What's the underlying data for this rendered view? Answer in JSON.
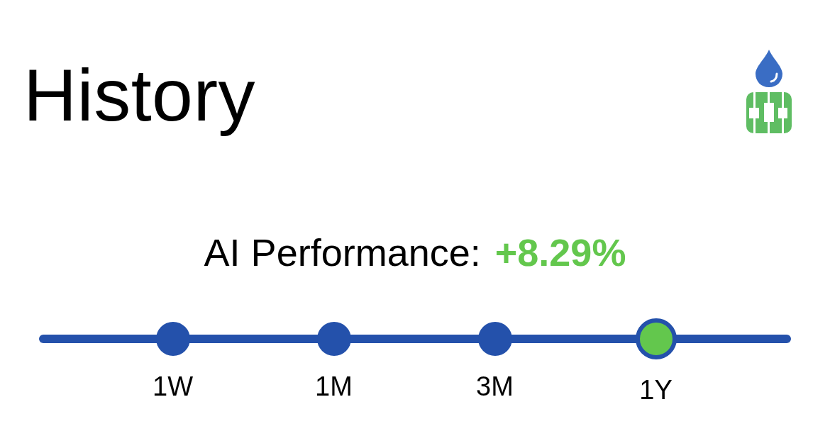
{
  "title": "History",
  "performance": {
    "label": "AI Performance:",
    "value": "+8.29%"
  },
  "periods": [
    {
      "label": "1W",
      "selected": false
    },
    {
      "label": "1M",
      "selected": false
    },
    {
      "label": "3M",
      "selected": false
    },
    {
      "label": "1Y",
      "selected": true
    }
  ]
}
